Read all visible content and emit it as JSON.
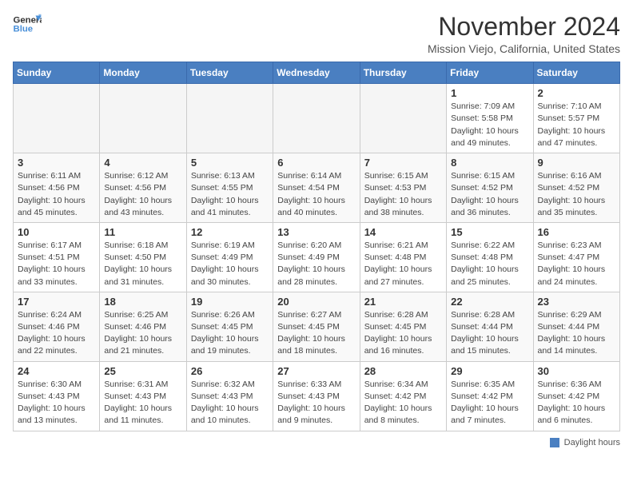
{
  "logo": {
    "line1": "General",
    "line2": "Blue"
  },
  "title": "November 2024",
  "location": "Mission Viejo, California, United States",
  "days_header": [
    "Sunday",
    "Monday",
    "Tuesday",
    "Wednesday",
    "Thursday",
    "Friday",
    "Saturday"
  ],
  "weeks": [
    [
      {
        "date": "",
        "info": ""
      },
      {
        "date": "",
        "info": ""
      },
      {
        "date": "",
        "info": ""
      },
      {
        "date": "",
        "info": ""
      },
      {
        "date": "",
        "info": ""
      },
      {
        "date": "1",
        "info": "Sunrise: 7:09 AM\nSunset: 5:58 PM\nDaylight: 10 hours\nand 49 minutes."
      },
      {
        "date": "2",
        "info": "Sunrise: 7:10 AM\nSunset: 5:57 PM\nDaylight: 10 hours\nand 47 minutes."
      }
    ],
    [
      {
        "date": "3",
        "info": "Sunrise: 6:11 AM\nSunset: 4:56 PM\nDaylight: 10 hours\nand 45 minutes."
      },
      {
        "date": "4",
        "info": "Sunrise: 6:12 AM\nSunset: 4:56 PM\nDaylight: 10 hours\nand 43 minutes."
      },
      {
        "date": "5",
        "info": "Sunrise: 6:13 AM\nSunset: 4:55 PM\nDaylight: 10 hours\nand 41 minutes."
      },
      {
        "date": "6",
        "info": "Sunrise: 6:14 AM\nSunset: 4:54 PM\nDaylight: 10 hours\nand 40 minutes."
      },
      {
        "date": "7",
        "info": "Sunrise: 6:15 AM\nSunset: 4:53 PM\nDaylight: 10 hours\nand 38 minutes."
      },
      {
        "date": "8",
        "info": "Sunrise: 6:15 AM\nSunset: 4:52 PM\nDaylight: 10 hours\nand 36 minutes."
      },
      {
        "date": "9",
        "info": "Sunrise: 6:16 AM\nSunset: 4:52 PM\nDaylight: 10 hours\nand 35 minutes."
      }
    ],
    [
      {
        "date": "10",
        "info": "Sunrise: 6:17 AM\nSunset: 4:51 PM\nDaylight: 10 hours\nand 33 minutes."
      },
      {
        "date": "11",
        "info": "Sunrise: 6:18 AM\nSunset: 4:50 PM\nDaylight: 10 hours\nand 31 minutes."
      },
      {
        "date": "12",
        "info": "Sunrise: 6:19 AM\nSunset: 4:49 PM\nDaylight: 10 hours\nand 30 minutes."
      },
      {
        "date": "13",
        "info": "Sunrise: 6:20 AM\nSunset: 4:49 PM\nDaylight: 10 hours\nand 28 minutes."
      },
      {
        "date": "14",
        "info": "Sunrise: 6:21 AM\nSunset: 4:48 PM\nDaylight: 10 hours\nand 27 minutes."
      },
      {
        "date": "15",
        "info": "Sunrise: 6:22 AM\nSunset: 4:48 PM\nDaylight: 10 hours\nand 25 minutes."
      },
      {
        "date": "16",
        "info": "Sunrise: 6:23 AM\nSunset: 4:47 PM\nDaylight: 10 hours\nand 24 minutes."
      }
    ],
    [
      {
        "date": "17",
        "info": "Sunrise: 6:24 AM\nSunset: 4:46 PM\nDaylight: 10 hours\nand 22 minutes."
      },
      {
        "date": "18",
        "info": "Sunrise: 6:25 AM\nSunset: 4:46 PM\nDaylight: 10 hours\nand 21 minutes."
      },
      {
        "date": "19",
        "info": "Sunrise: 6:26 AM\nSunset: 4:45 PM\nDaylight: 10 hours\nand 19 minutes."
      },
      {
        "date": "20",
        "info": "Sunrise: 6:27 AM\nSunset: 4:45 PM\nDaylight: 10 hours\nand 18 minutes."
      },
      {
        "date": "21",
        "info": "Sunrise: 6:28 AM\nSunset: 4:45 PM\nDaylight: 10 hours\nand 16 minutes."
      },
      {
        "date": "22",
        "info": "Sunrise: 6:28 AM\nSunset: 4:44 PM\nDaylight: 10 hours\nand 15 minutes."
      },
      {
        "date": "23",
        "info": "Sunrise: 6:29 AM\nSunset: 4:44 PM\nDaylight: 10 hours\nand 14 minutes."
      }
    ],
    [
      {
        "date": "24",
        "info": "Sunrise: 6:30 AM\nSunset: 4:43 PM\nDaylight: 10 hours\nand 13 minutes."
      },
      {
        "date": "25",
        "info": "Sunrise: 6:31 AM\nSunset: 4:43 PM\nDaylight: 10 hours\nand 11 minutes."
      },
      {
        "date": "26",
        "info": "Sunrise: 6:32 AM\nSunset: 4:43 PM\nDaylight: 10 hours\nand 10 minutes."
      },
      {
        "date": "27",
        "info": "Sunrise: 6:33 AM\nSunset: 4:43 PM\nDaylight: 10 hours\nand 9 minutes."
      },
      {
        "date": "28",
        "info": "Sunrise: 6:34 AM\nSunset: 4:42 PM\nDaylight: 10 hours\nand 8 minutes."
      },
      {
        "date": "29",
        "info": "Sunrise: 6:35 AM\nSunset: 4:42 PM\nDaylight: 10 hours\nand 7 minutes."
      },
      {
        "date": "30",
        "info": "Sunrise: 6:36 AM\nSunset: 4:42 PM\nDaylight: 10 hours\nand 6 minutes."
      }
    ]
  ],
  "footer": {
    "label": "Daylight hours"
  }
}
